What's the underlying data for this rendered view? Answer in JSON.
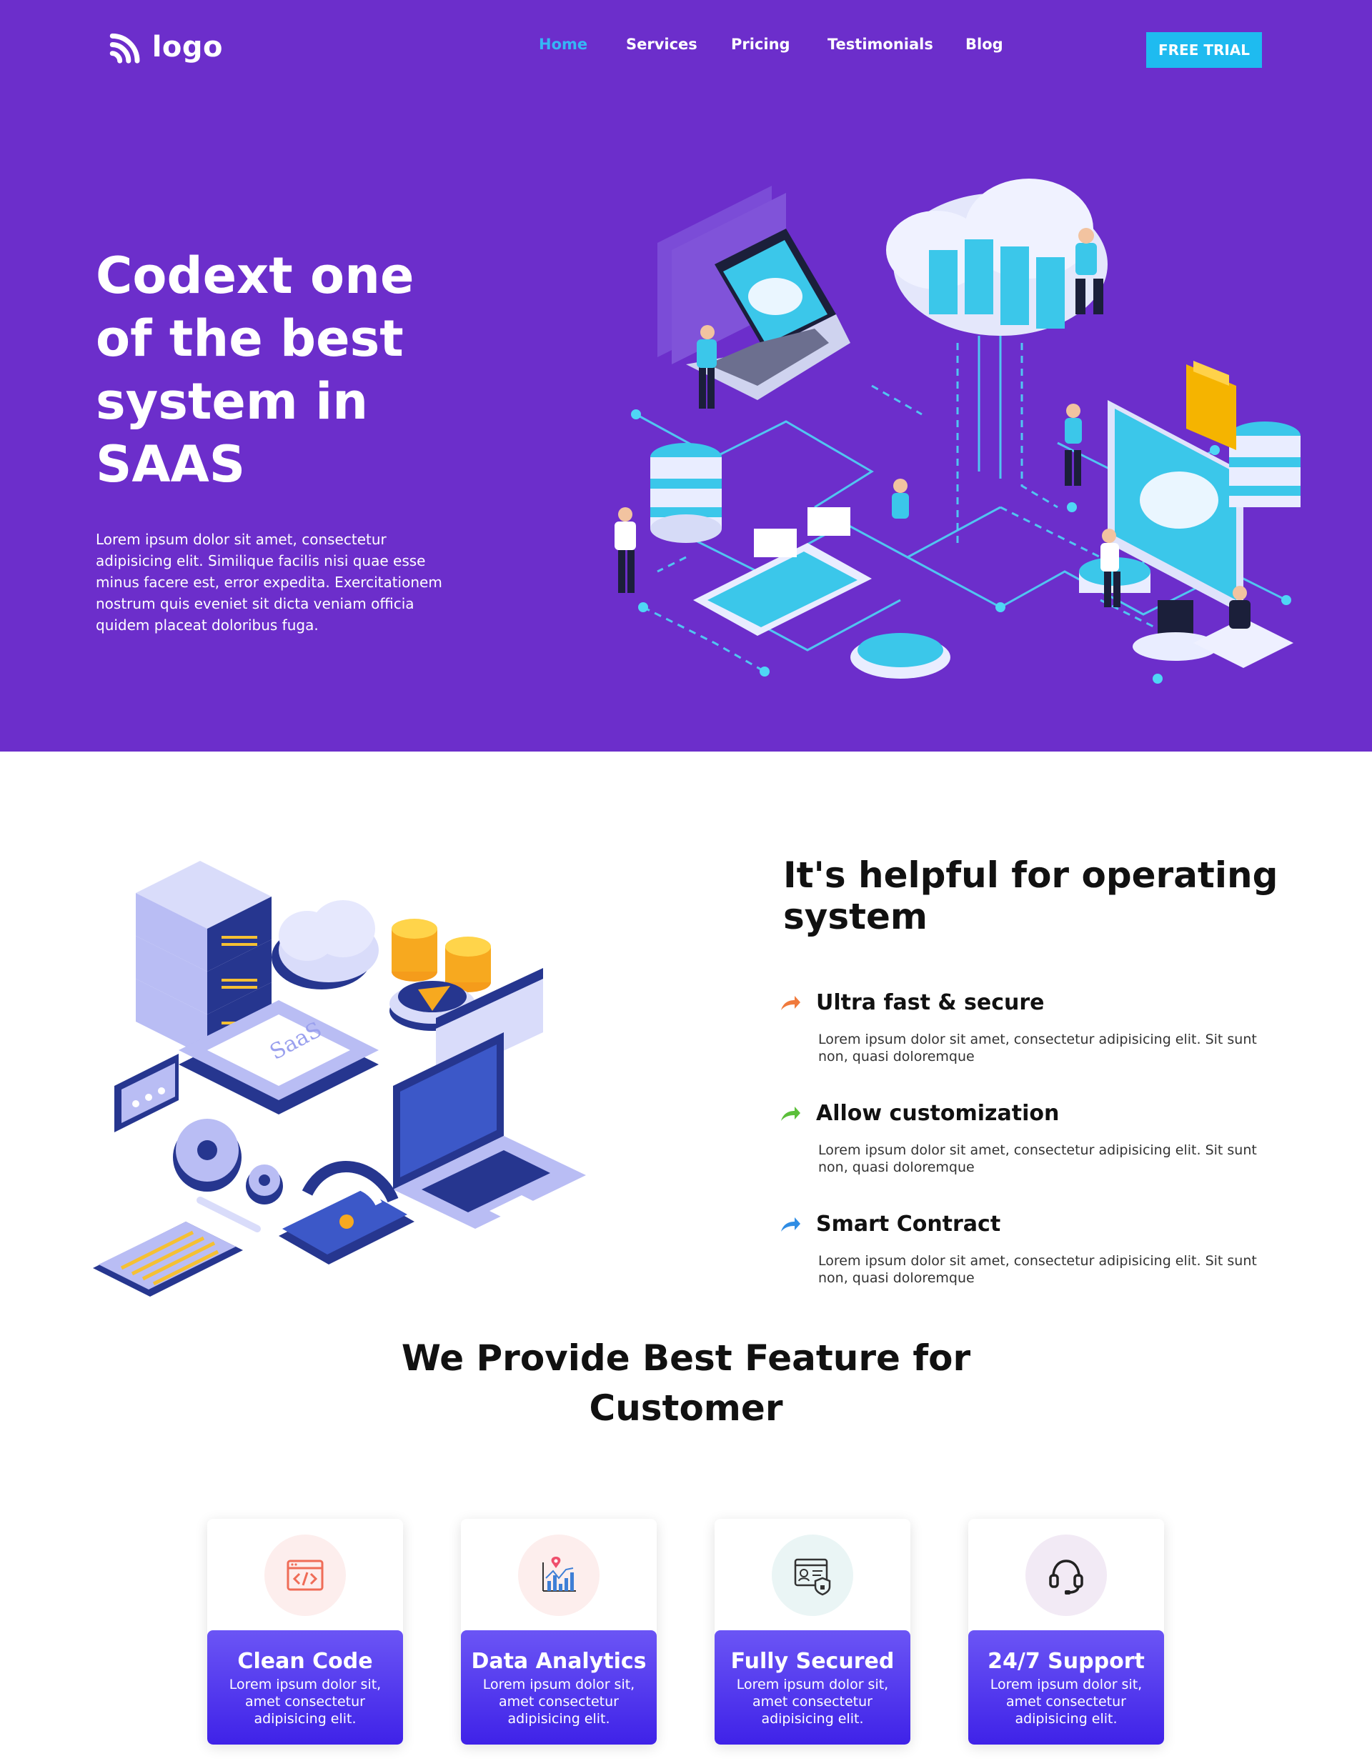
{
  "header": {
    "logo_text": "logo",
    "nav": [
      "Home",
      "Services",
      "Pricing",
      "Testimonials",
      "Blog"
    ],
    "active_nav": "Home",
    "cta_label": "FREE TRIAL"
  },
  "hero": {
    "title": "Codext one of the best system in SAAS",
    "text": "Lorem ipsum dolor sit amet, consectetur adipisicing elit. Similique facilis nisi quae esse minus facere est, error expedita. Exercitationem nostrum quis eveniet sit dicta veniam officia quidem placeat doloribus fuga.",
    "illustration_labels": []
  },
  "os_section": {
    "title": "It's helpful for operating system",
    "illustration_label": "SaaS",
    "features": [
      {
        "title": "Ultra fast & secure",
        "text": "Lorem ipsum dolor sit amet, consectetur adipisicing elit. Sit sunt non, quasi doloremque",
        "icon": "arrow-icon",
        "color": "#f07a3c"
      },
      {
        "title": "Allow customization",
        "text": "Lorem ipsum dolor sit amet, consectetur adipisicing elit. Sit sunt non, quasi doloremque",
        "icon": "arrow-icon",
        "color": "#5bbf3a"
      },
      {
        "title": "Smart Contract",
        "text": "Lorem ipsum dolor sit amet, consectetur adipisicing elit. Sit sunt non, quasi doloremque",
        "icon": "arrow-icon",
        "color": "#2f8de4"
      }
    ]
  },
  "best_feature": {
    "title": "We Provide Best Feature for Customer",
    "cards": [
      {
        "title": "Clean Code",
        "text": "Lorem ipsum dolor sit, amet consectetur adipisicing elit.",
        "icon": "code-icon",
        "icon_bg": "#fdeeed",
        "icon_color": "#ef6c57"
      },
      {
        "title": "Data Analytics",
        "text": "Lorem ipsum dolor sit, amet consectetur adipisicing elit.",
        "icon": "analytics-icon",
        "icon_bg": "#fdeeed",
        "icon_color": "#3f7fd6"
      },
      {
        "title": "Fully Secured",
        "text": "Lorem ipsum dolor sit, amet consectetur adipisicing elit.",
        "icon": "security-icon",
        "icon_bg": "#eaf5f5",
        "icon_color": "#333333"
      },
      {
        "title": "24/7 Support",
        "text": "Lorem ipsum dolor sit, amet consectetur adipisicing elit.",
        "icon": "headset-icon",
        "icon_bg": "#f2eaf5",
        "icon_color": "#222222"
      }
    ]
  },
  "colors": {
    "hero_bg": "#6c2ecb",
    "accent": "#1ebbf0",
    "card_gradient_top": "#6b55f5",
    "card_gradient_bottom": "#3f22e8"
  }
}
